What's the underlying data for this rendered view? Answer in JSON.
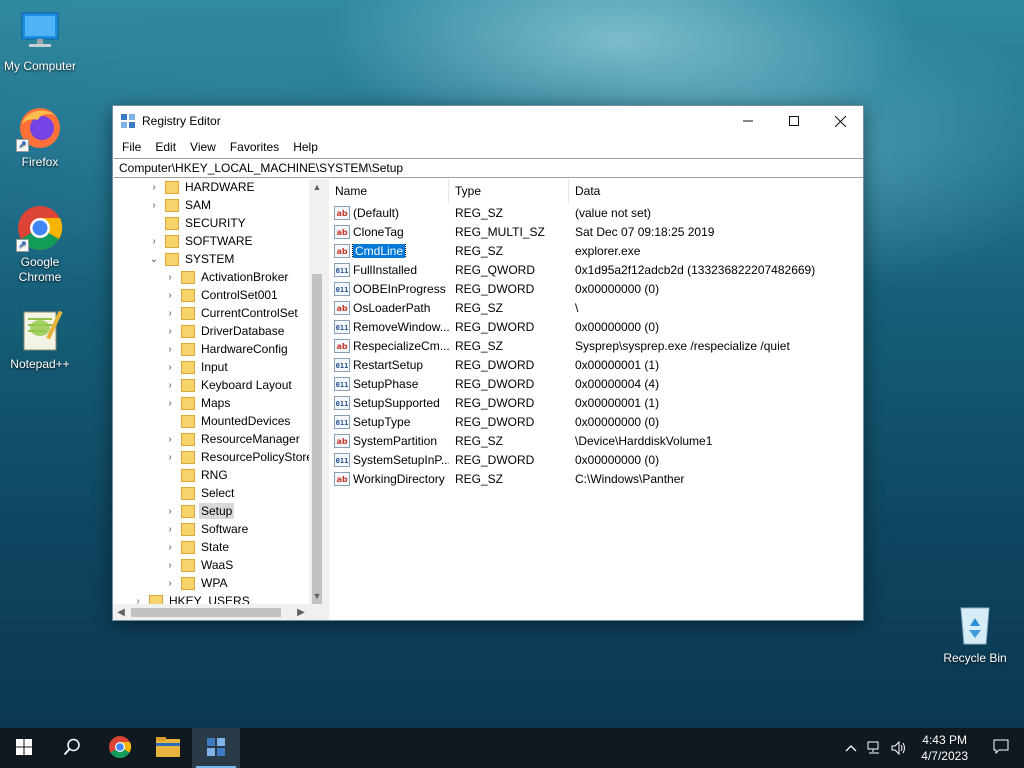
{
  "desktop": {
    "icons": [
      {
        "label": "My Computer",
        "icon": "computer-icon"
      },
      {
        "label": "Firefox",
        "icon": "firefox-icon"
      },
      {
        "label": "Google Chrome",
        "icon": "chrome-icon"
      },
      {
        "label": "Notepad++",
        "icon": "notepadpp-icon"
      },
      {
        "label": "Recycle Bin",
        "icon": "recycle-bin-icon"
      }
    ]
  },
  "window": {
    "title": "Registry Editor",
    "menu": [
      "File",
      "Edit",
      "View",
      "Favorites",
      "Help"
    ],
    "address": "Computer\\HKEY_LOCAL_MACHINE\\SYSTEM\\Setup",
    "tree": {
      "top": [
        {
          "label": "HARDWARE",
          "expander": "›"
        },
        {
          "label": "SAM",
          "expander": "›"
        },
        {
          "label": "SECURITY",
          "expander": ""
        },
        {
          "label": "SOFTWARE",
          "expander": "›"
        },
        {
          "label": "SYSTEM",
          "expander": "⌄"
        }
      ],
      "system_children": [
        {
          "label": "ActivationBroker",
          "expander": "›"
        },
        {
          "label": "ControlSet001",
          "expander": "›"
        },
        {
          "label": "CurrentControlSet",
          "expander": "›"
        },
        {
          "label": "DriverDatabase",
          "expander": "›"
        },
        {
          "label": "HardwareConfig",
          "expander": "›"
        },
        {
          "label": "Input",
          "expander": "›"
        },
        {
          "label": "Keyboard Layout",
          "expander": "›"
        },
        {
          "label": "Maps",
          "expander": "›"
        },
        {
          "label": "MountedDevices",
          "expander": ""
        },
        {
          "label": "ResourceManager",
          "expander": "›"
        },
        {
          "label": "ResourcePolicyStore",
          "expander": "›"
        },
        {
          "label": "RNG",
          "expander": ""
        },
        {
          "label": "Select",
          "expander": ""
        },
        {
          "label": "Setup",
          "expander": "›",
          "selected": true
        },
        {
          "label": "Software",
          "expander": "›"
        },
        {
          "label": "State",
          "expander": "›"
        },
        {
          "label": "WaaS",
          "expander": "›"
        },
        {
          "label": "WPA",
          "expander": "›"
        }
      ],
      "bottom": [
        {
          "label": "HKEY_USERS",
          "expander": "›"
        }
      ]
    },
    "columns": {
      "name": "Name",
      "type": "Type",
      "data": "Data"
    },
    "values": [
      {
        "name": "(Default)",
        "type": "REG_SZ",
        "data": "(value not set)",
        "kind": "sz"
      },
      {
        "name": "CloneTag",
        "type": "REG_MULTI_SZ",
        "data": "Sat Dec 07 09:18:25 2019",
        "kind": "sz"
      },
      {
        "name": "CmdLine",
        "type": "REG_SZ",
        "data": "explorer.exe",
        "kind": "sz",
        "selected": true
      },
      {
        "name": "FullInstalled",
        "type": "REG_QWORD",
        "data": "0x1d95a2f12adcb2d (133236822207482669)",
        "kind": "bin"
      },
      {
        "name": "OOBEInProgress",
        "type": "REG_DWORD",
        "data": "0x00000000 (0)",
        "kind": "bin"
      },
      {
        "name": "OsLoaderPath",
        "type": "REG_SZ",
        "data": "\\",
        "kind": "sz"
      },
      {
        "name": "RemoveWindow...",
        "type": "REG_DWORD",
        "data": "0x00000000 (0)",
        "kind": "bin"
      },
      {
        "name": "RespecializeCm...",
        "type": "REG_SZ",
        "data": "Sysprep\\sysprep.exe /respecialize /quiet",
        "kind": "sz"
      },
      {
        "name": "RestartSetup",
        "type": "REG_DWORD",
        "data": "0x00000001 (1)",
        "kind": "bin"
      },
      {
        "name": "SetupPhase",
        "type": "REG_DWORD",
        "data": "0x00000004 (4)",
        "kind": "bin"
      },
      {
        "name": "SetupSupported",
        "type": "REG_DWORD",
        "data": "0x00000001 (1)",
        "kind": "bin"
      },
      {
        "name": "SetupType",
        "type": "REG_DWORD",
        "data": "0x00000000 (0)",
        "kind": "bin"
      },
      {
        "name": "SystemPartition",
        "type": "REG_SZ",
        "data": "\\Device\\HarddiskVolume1",
        "kind": "sz"
      },
      {
        "name": "SystemSetupInP...",
        "type": "REG_DWORD",
        "data": "0x00000000 (0)",
        "kind": "bin"
      },
      {
        "name": "WorkingDirectory",
        "type": "REG_SZ",
        "data": "C:\\Windows\\Panther",
        "kind": "sz"
      }
    ],
    "value_icon_text": {
      "sz": "ab",
      "bin": "011"
    }
  },
  "taskbar": {
    "time": "4:43 PM",
    "date": "4/7/2023",
    "tray_icons": [
      "chevron-up-icon",
      "network-icon",
      "volume-icon"
    ],
    "apps": [
      "start-icon",
      "search-icon",
      "chrome-icon",
      "file-explorer-icon",
      "regedit-icon"
    ],
    "active_app": "regedit-icon"
  },
  "colors": {
    "selection": "#0078d7",
    "folder": "#f6d36b",
    "taskbar": "#101820"
  }
}
